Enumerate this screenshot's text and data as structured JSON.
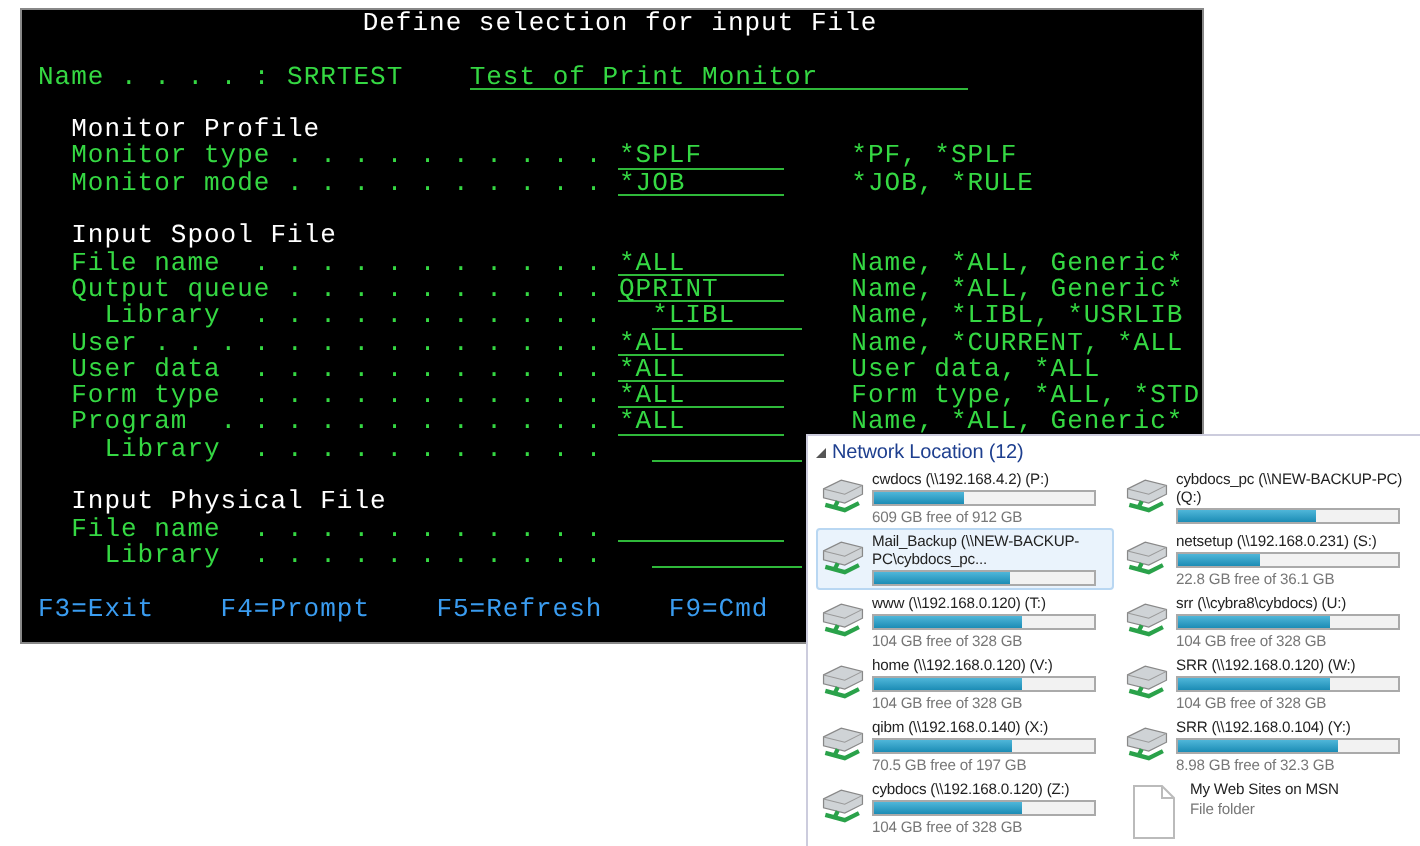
{
  "terminal": {
    "title": "Define selection for input File",
    "name_label": "Name . . . . :",
    "name_value": "SRRTEST",
    "description": "Test of Print Monitor",
    "sections": [
      {
        "heading": "Monitor Profile",
        "fields": [
          {
            "label": "Monitor type . . . . . . . . . .",
            "value": "*SPLF",
            "hint": "*PF, *SPLF"
          },
          {
            "label": "Monitor mode . . . . . . . . . .",
            "value": "*JOB",
            "hint": "*JOB, *RULE"
          }
        ]
      },
      {
        "heading": "Input Spool File",
        "fields": [
          {
            "label": "File name  . . . . . . . . . . .",
            "value": "*ALL",
            "hint": "Name, *ALL, Generic*"
          },
          {
            "label": "Qutput queue . . . . . . . . . .",
            "value": "QPRINT",
            "hint": "Name, *ALL, Generic*",
            "children": [
              {
                "label": "Library  . . . . . . . . . . .",
                "value": "*LIBL",
                "hint": "Name, *LIBL, *USRLIB"
              }
            ]
          },
          {
            "label": "User . . . . . . . . . . . . . .",
            "value": "*ALL",
            "hint": "Name, *CURRENT, *ALL"
          },
          {
            "label": "User data  . . . . . . . . . . .",
            "value": "*ALL",
            "hint": "User data, *ALL"
          },
          {
            "label": "Form type  . . . . . . . . . . .",
            "value": "*ALL",
            "hint": "Form type, *ALL, *STD"
          },
          {
            "label": "Program  . . . . . . . . . . . .",
            "value": "*ALL",
            "hint": "Name, *ALL, Generic*",
            "children": [
              {
                "label": "Library  . . . . . . . . . . ."
              }
            ]
          }
        ]
      },
      {
        "heading": "Input Physical File",
        "fields": [
          {
            "label": "File name  . . . . . . . . . . .",
            "children": [
              {
                "label": "Library  . . . . . . . . . . ."
              }
            ]
          }
        ]
      }
    ],
    "function_keys": [
      "F3=Exit",
      "F4=Prompt",
      "F5=Refresh",
      "F9=Cmd"
    ]
  },
  "explorer": {
    "group": "Network Location (12)",
    "items": [
      {
        "kind": "drive",
        "name": "cwdocs (\\\\192.168.4.2) (P:)",
        "level": 0.41,
        "free": "609 GB free of 912 GB",
        "selected": false
      },
      {
        "kind": "drive",
        "name": "cybdocs_pc (\\\\NEW-BACKUP-PC) (Q:)",
        "level": 0.63,
        "selected": false
      },
      {
        "kind": "drive",
        "name": "Mail_Backup (\\\\NEW-BACKUP-PC\\cybdocs_pc...",
        "level": 0.62,
        "selected": true
      },
      {
        "kind": "drive",
        "name": "netsetup (\\\\192.168.0.231) (S:)",
        "level": 0.37,
        "free": "22.8 GB free of 36.1 GB",
        "selected": false
      },
      {
        "kind": "drive",
        "name": "www (\\\\192.168.0.120) (T:)",
        "level": 0.67,
        "free": "104 GB free of 328 GB",
        "selected": false
      },
      {
        "kind": "drive",
        "name": "srr (\\\\cybra8\\cybdocs) (U:)",
        "level": 0.69,
        "free": "104 GB free of 328 GB",
        "selected": false
      },
      {
        "kind": "drive",
        "name": "home (\\\\192.168.0.120) (V:)",
        "level": 0.67,
        "free": "104 GB free of 328 GB",
        "selected": false
      },
      {
        "kind": "drive",
        "name": "SRR (\\\\192.168.0.120) (W:)",
        "level": 0.69,
        "free": "104 GB free of 328 GB",
        "selected": false
      },
      {
        "kind": "drive",
        "name": "qibm (\\\\192.168.0.140) (X:)",
        "level": 0.63,
        "free": "70.5 GB free of 197 GB",
        "selected": false
      },
      {
        "kind": "drive",
        "name": "SRR (\\\\192.168.0.104) (Y:)",
        "level": 0.73,
        "free": "8.98 GB free of 32.3 GB",
        "selected": false
      },
      {
        "kind": "drive",
        "name": "cybdocs (\\\\192.168.0.120) (Z:)",
        "level": 0.67,
        "free": "104 GB free of 328 GB",
        "selected": false
      },
      {
        "kind": "folder",
        "name": "My Web Sites on MSN",
        "free": "File folder",
        "selected": false
      }
    ]
  }
}
